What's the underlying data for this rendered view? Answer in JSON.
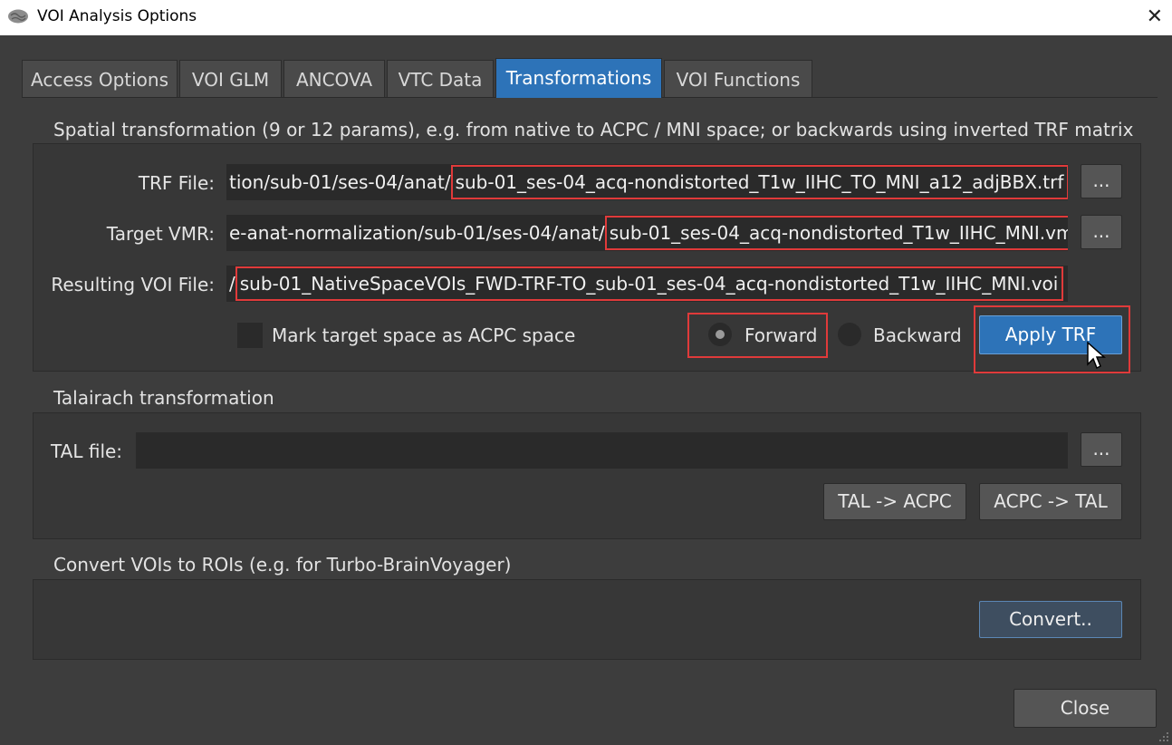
{
  "window": {
    "title": "VOI Analysis Options",
    "close_glyph": "✕"
  },
  "tabs": [
    "Access Options",
    "VOI GLM",
    "ANCOVA",
    "VTC Data",
    "Transformations",
    "VOI Functions"
  ],
  "active_tab": "Transformations",
  "spatial": {
    "heading": "Spatial transformation (9 or 12 params), e.g. from native to ACPC / MNI space; or backwards using inverted TRF matrix",
    "trf_label": "TRF File:",
    "trf_prefix": "tion/sub-01/ses-04/anat/",
    "trf_filename": "sub-01_ses-04_acq-nondistorted_T1w_IIHC_TO_MNI_a12_adjBBX.trf",
    "target_label": "Target VMR:",
    "target_prefix": "e-anat-normalization/sub-01/ses-04/anat/",
    "target_filename": "sub-01_ses-04_acq-nondistorted_T1w_IIHC_MNI.vmr",
    "result_label": "Resulting VOI File:",
    "result_prefix": "/",
    "result_filename": "sub-01_NativeSpaceVOIs_FWD-TRF-TO_sub-01_ses-04_acq-nondistorted_T1w_IIHC_MNI.voi",
    "browse_label": "...",
    "mark_acpc_label": "Mark target space as ACPC space",
    "forward_label": "Forward",
    "backward_label": "Backward",
    "direction_selected": "Forward",
    "apply_label": "Apply TRF"
  },
  "talairach": {
    "heading": "Talairach transformation",
    "tal_label": "TAL file:",
    "tal_value": "",
    "browse_label": "...",
    "tal_to_acpc": "TAL -> ACPC",
    "acpc_to_tal": "ACPC -> TAL"
  },
  "convert": {
    "heading": "Convert VOIs to ROIs (e.g. for Turbo-BrainVoyager)",
    "button": "Convert.."
  },
  "close_button": "Close",
  "colors": {
    "accent": "#2d73b8",
    "highlight": "#e03a3a",
    "background": "#3d3d3d"
  }
}
